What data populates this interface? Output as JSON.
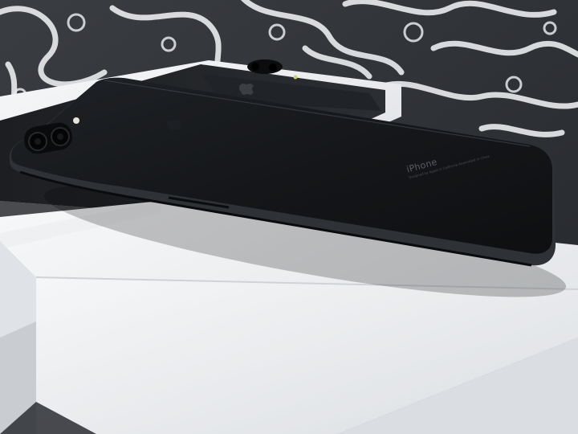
{
  "photo": {
    "subject": "matte black iPhone 7 Plus lying on white product boxes",
    "phone": {
      "engraving": "iPhone",
      "engraving_fine_print": "Designed by Apple in California Assembled in China"
    },
    "colors": {
      "backdrop_dark": "#2a2d31",
      "backdrop_pattern": "#e6e8ea",
      "box_white": "#f1f2f4",
      "box_shadow": "#cfd3d8",
      "box_lid_black": "#1b1d20",
      "phone_black": "#16181b",
      "phone_edge": "#2e3135"
    },
    "icons": [
      "apple-logo-icon",
      "camera-lens-icon",
      "flash-icon"
    ]
  }
}
